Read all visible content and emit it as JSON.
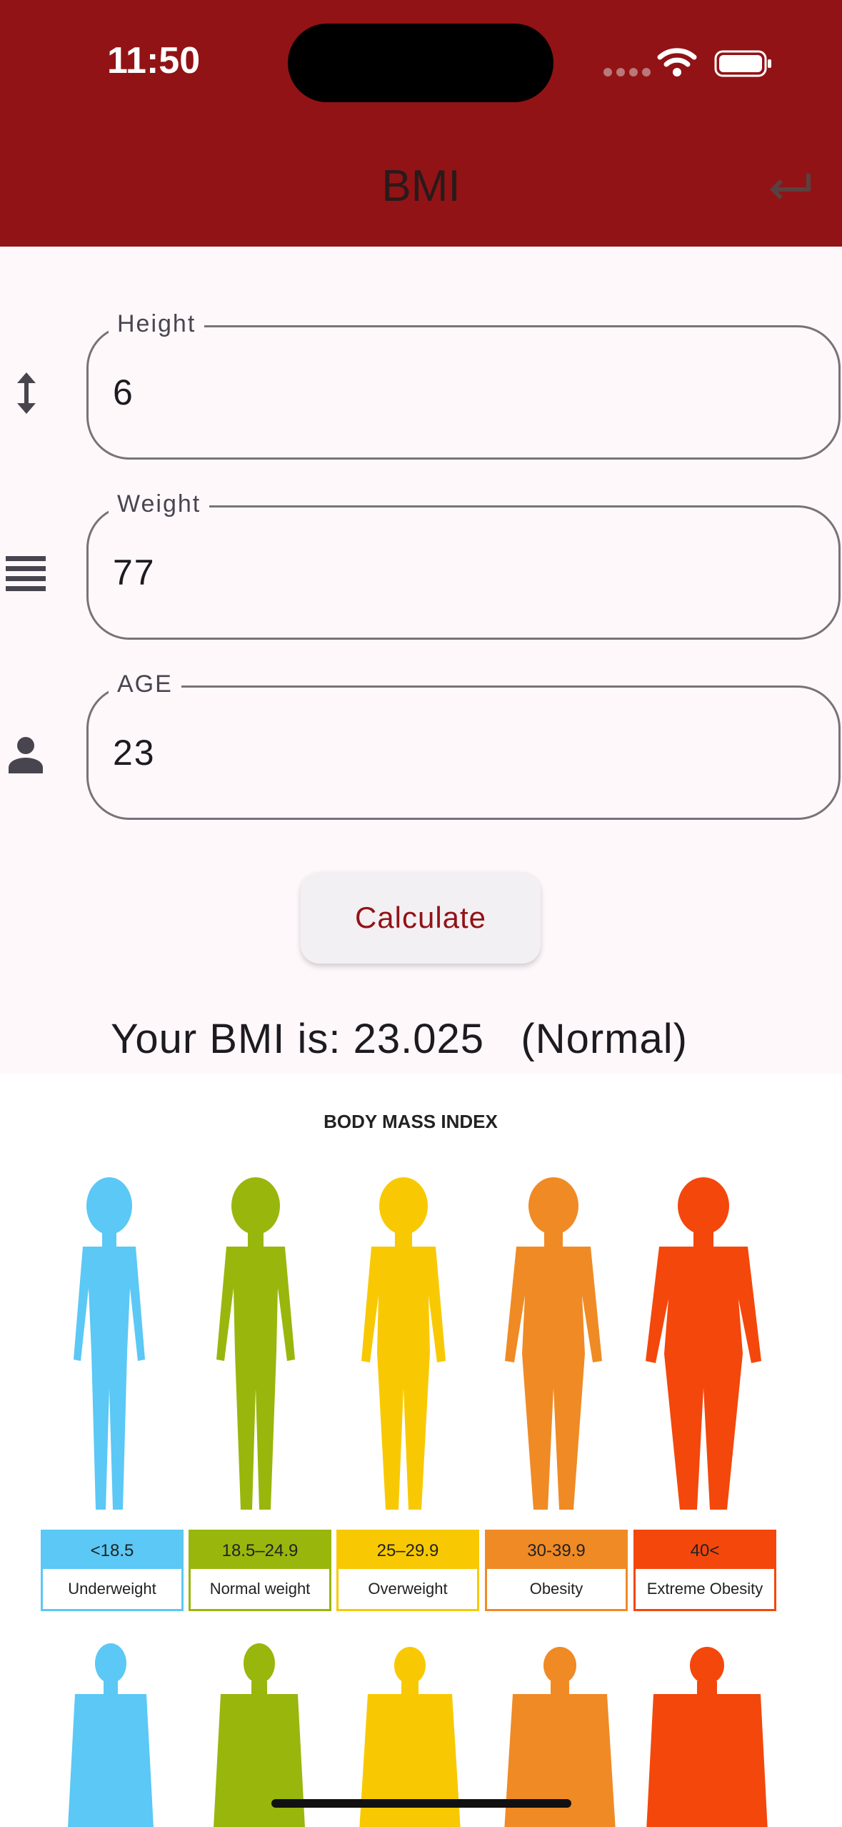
{
  "status_bar": {
    "time": "11:50"
  },
  "app_bar": {
    "title": "BMI"
  },
  "form": {
    "height": {
      "label": "Height",
      "value": "6"
    },
    "weight": {
      "label": "Weight",
      "value": "77"
    },
    "age": {
      "label": "AGE",
      "value": "23"
    }
  },
  "actions": {
    "calculate_label": "Calculate"
  },
  "result": {
    "text": "Your BMI is: 23.025   (Normal)"
  },
  "chart": {
    "title": "BODY MASS INDEX",
    "categories": [
      {
        "range": "<18.5",
        "label": "Underweight",
        "color": "#5bc8f5"
      },
      {
        "range": "18.5–24.9",
        "label": "Normal weight",
        "color": "#99b60d"
      },
      {
        "range": "25–29.9",
        "label": "Overweight",
        "color": "#f8c902"
      },
      {
        "range": "30-39.9",
        "label": "Obesity",
        "color": "#f08a25"
      },
      {
        "range": "40<",
        "label": "Extreme Obesity",
        "color": "#f4470c"
      }
    ]
  },
  "colors": {
    "app_bar": "#921315",
    "accent": "#921315",
    "background": "#fef8fb"
  }
}
